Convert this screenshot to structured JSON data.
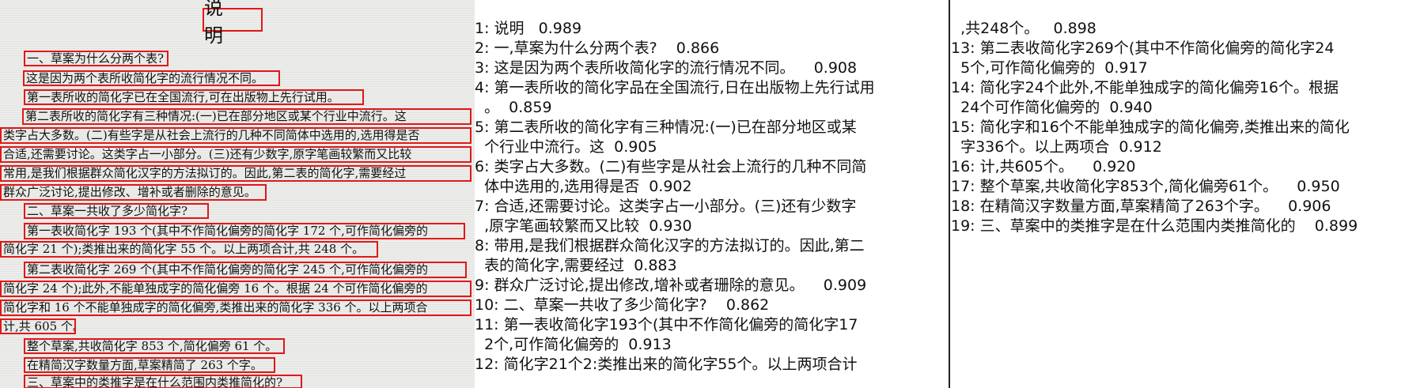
{
  "doc": {
    "title": "说 明",
    "lines": [
      "一、草案为什么分两个表?",
      "这是因为两个表所收简化字的流行情况不同。",
      "第一表所收的简化字已在全国流行,可在出版物上先行试用。",
      "第二表所收的简化字有三种情况:(一)已在部分地区或某个行业中流行。这",
      "类字占大多数。(二)有些字是从社会上流行的几种不同简体中选用的,选用得是否",
      "合适,还需要讨论。这类字占一小部分。(三)还有少数字,原字笔画较繁而又比较",
      "常用,是我们根据群众简化汉字的方法拟订的。因此,第二表的简化字,需要经过",
      "群众广泛讨论,提出修改、增补或者删除的意见。",
      "二、草案一共收了多少简化字?",
      "第一表收简化字 193 个(其中不作简化偏旁的简化字 172 个,可作简化偏旁的",
      "简化字 21 个);类推出来的简化字 55 个。以上两项合计,共 248 个。",
      "第二表收简化字 269 个(其中不作简化偏旁的简化字 245 个,可作简化偏旁的",
      "简化字 24 个);此外,不能单独成字的简化偏旁 16 个。根据 24 个可作简化偏旁的",
      "简化字和 16 个不能单独成字的简化偏旁,类推出来的简化字 336 个。以上两项合",
      "计,共 605 个。",
      "整个草案,共收简化字 853 个,简化偏旁 61 个。",
      "在精简汉字数量方面,草案精简了 263 个字。",
      "三、草案中的类推字是在什么范围内类推简化的?"
    ]
  },
  "results_mid": [
    "1: 说明   0.989",
    "2: 一,草案为什么分两个表?    0.866",
    "3: 这是因为两个表所收简化字的流行情况不同。    0.908",
    "4: 第一表所收的简化字品在全国流行,日在出版物上先行试用",
    "  。  0.859",
    "5: 第二表所收的简化字有三种情况:(一)已在部分地区或某",
    "  个行业中流行。这  0.905",
    "6: 类字占大多数。(二)有些字是从社会上流行的几种不同简",
    "  体中选用的,选用得是否  0.902",
    "7: 合适,还需要讨论。这类字占一小部分。(三)还有少数字",
    "  ,原字笔画较繁而又比较  0.930",
    "8: 带用,是我们根据群众简化汉字的方法拟订的。因此,第二",
    "  表的简化字,需要经过  0.883",
    "9: 群众广泛讨论,提出修改,增补或者珊除的意见。    0.909",
    "10: 二、草案一共收了多少简化字?    0.862",
    "11: 第一表收简化字193个(其中不作简化偏旁的简化字17",
    "  2个,可作简化偏旁的  0.913",
    "12: 简化字21个2:类推出来的简化字55个。以上两项合计"
  ],
  "results_right": [
    "  ,共248个。   0.898",
    "13: 第二表收简化字269个(其中不作简化偏旁的简化字24",
    "  5个,可作简化偏旁的  0.917",
    "14: 简化字24个此外,不能单独成字的简化偏旁16个。根据",
    "  24个可作简化偏旁的  0.940",
    "15: 简化字和16个不能单独成字的简化偏旁,类推出来的简化",
    "  字336个。以上两项合  0.912",
    "16: 计,共605个。    0.920",
    "17: 整个草案,共收简化字853个,简化偏旁61个。    0.950",
    "18: 在精简汉字数量方面,草案精简了263个字。    0.906",
    "19: 三、草案中的类推字是在什么范围内类推简化的    0.899"
  ],
  "colors": {
    "box": "#e01818",
    "text": "#111111",
    "divider": "#222222"
  }
}
